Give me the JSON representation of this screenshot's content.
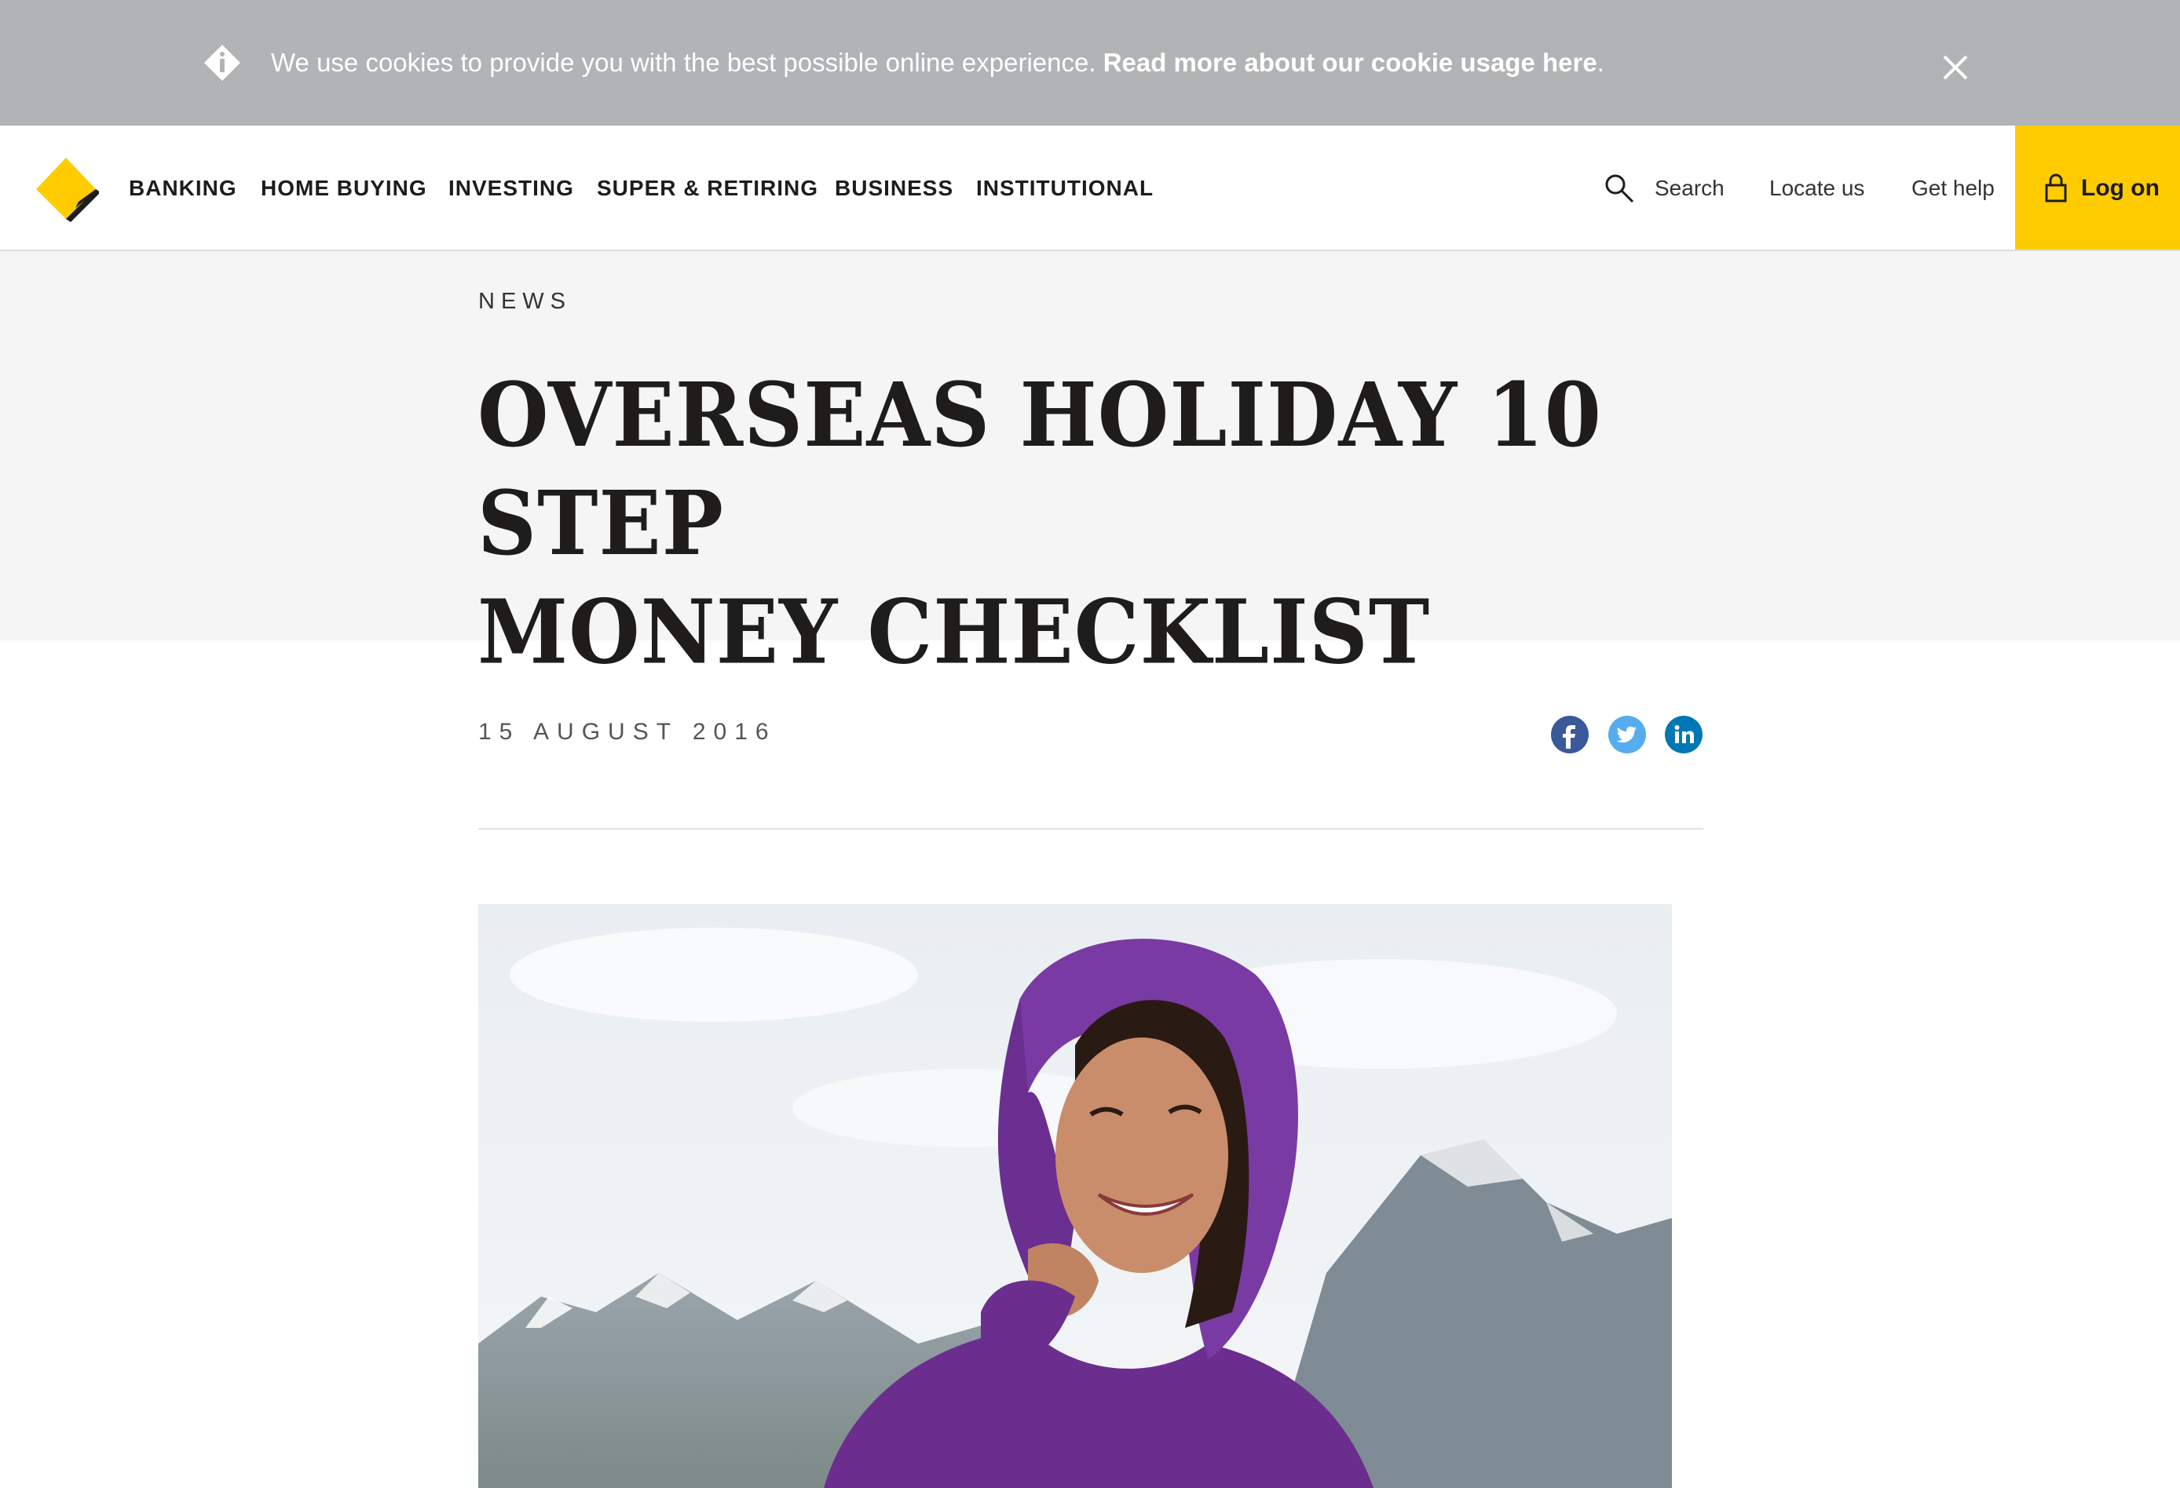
{
  "cookie_banner": {
    "message": "We use cookies to provide you with the best possible online experience. ",
    "link_text": "Read more about our cookie usage here",
    "suffix": "."
  },
  "nav": {
    "items": [
      "BANKING",
      "HOME BUYING",
      "INVESTING",
      "SUPER & RETIRING",
      "BUSINESS",
      "INSTITUTIONAL"
    ],
    "search_label": "Search",
    "locate_label": "Locate us",
    "help_label": "Get help",
    "logon_label": "Log on"
  },
  "article": {
    "category": "NEWS",
    "title_line1": "OVERSEAS HOLIDAY 10 STEP",
    "title_line2": "MONEY CHECKLIST",
    "date": "15 AUGUST 2016"
  },
  "share": {
    "icons": [
      "facebook-icon",
      "twitter-icon",
      "linkedin-icon"
    ]
  },
  "colors": {
    "brand_yellow": "#ffcc00",
    "cookie_bar": "#b1b3b5",
    "title_band": "#f5f5f5",
    "facebook": "#3b5998",
    "twitter": "#55acee",
    "linkedin": "#0077b5"
  },
  "icons": {
    "info": "info-icon",
    "close": "close-icon",
    "search": "search-icon",
    "lock": "lock-icon",
    "logo": "commbank-diamond-logo"
  }
}
